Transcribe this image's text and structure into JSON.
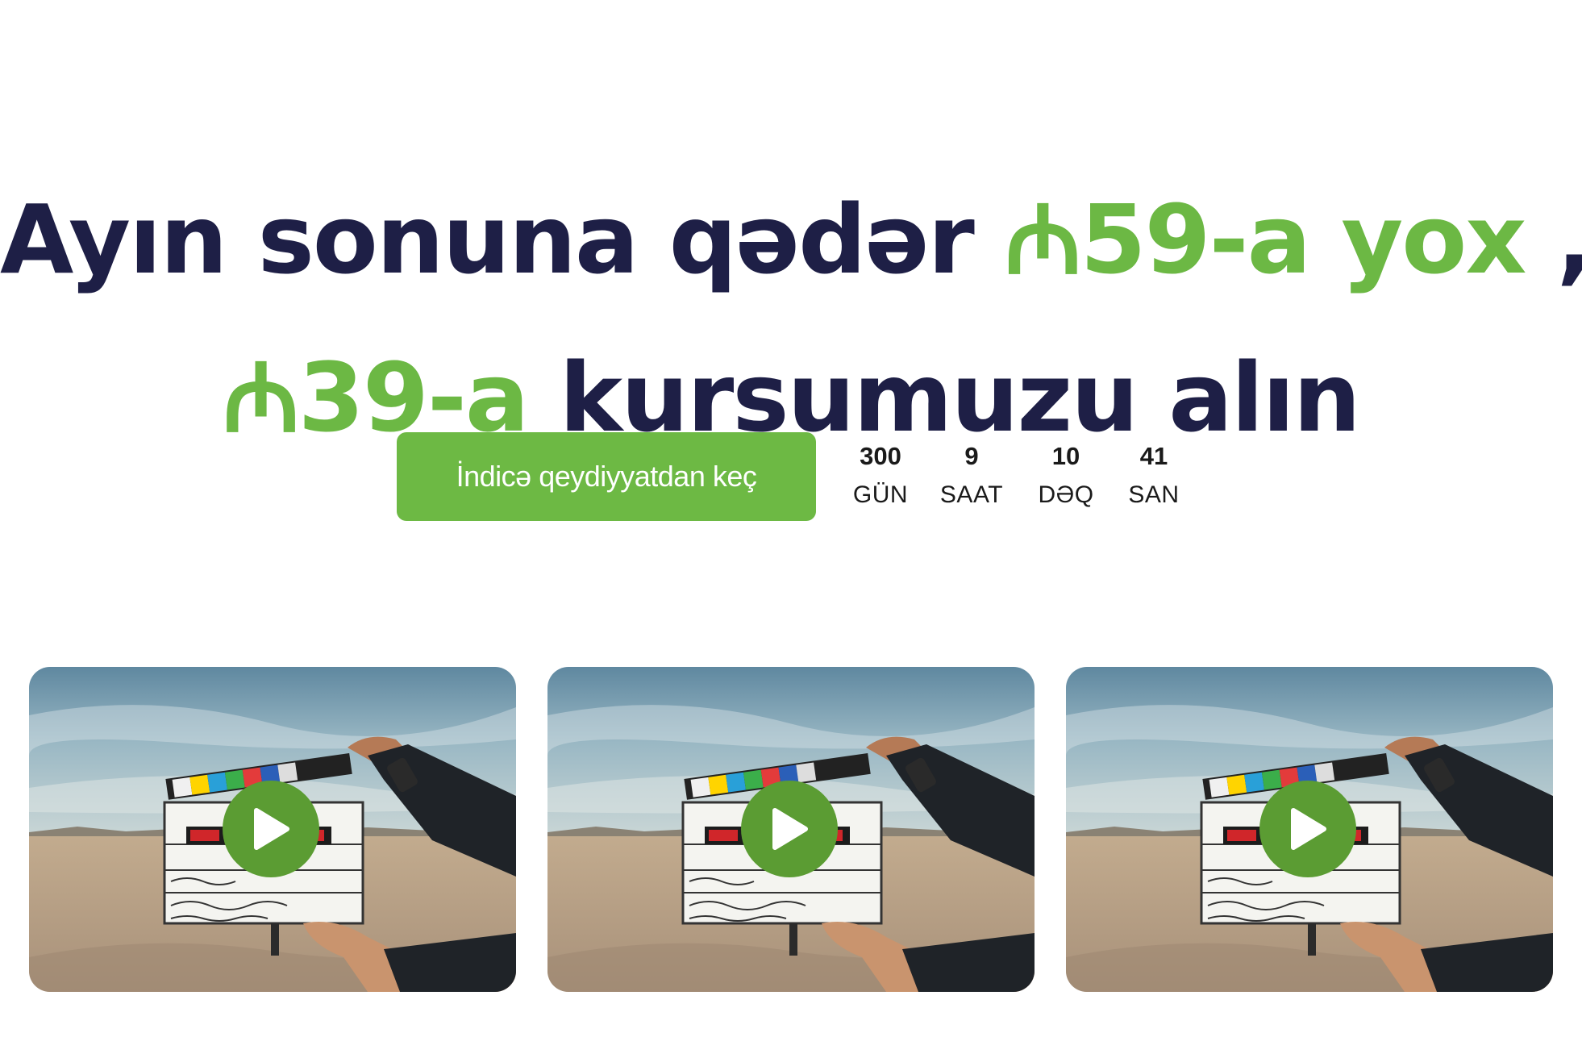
{
  "headline": {
    "part1": "Ayın sonuna qədər ",
    "old_price": "₼59-a yox",
    "part2": " ,",
    "new_price": "₼39-a",
    "part3": " kursumuzu alın"
  },
  "cta": {
    "register_label": "İndicə qeydiyyatdan keç"
  },
  "countdown": [
    {
      "value": "300",
      "label": "GÜN"
    },
    {
      "value": "9",
      "label": "SAAT"
    },
    {
      "value": "10",
      "label": "DƏQ"
    },
    {
      "value": "41",
      "label": "SAN"
    }
  ],
  "videos": [
    {
      "icon": "play-icon",
      "slate_lines": [
        "Roadside",
        "Jakob & Ryan",
        "Thomas Taugher"
      ]
    },
    {
      "icon": "play-icon",
      "slate_lines": [
        "Roadside",
        "Jakob & Ryan",
        "Thomas Taugher"
      ]
    },
    {
      "icon": "play-icon",
      "slate_lines": [
        "Roadside",
        "Jakob & Ryan",
        "Thomas Taugher"
      ]
    }
  ],
  "colors": {
    "heading": "#1e1f46",
    "accent_green": "#6cb844",
    "play_green": "#5b9c33"
  }
}
